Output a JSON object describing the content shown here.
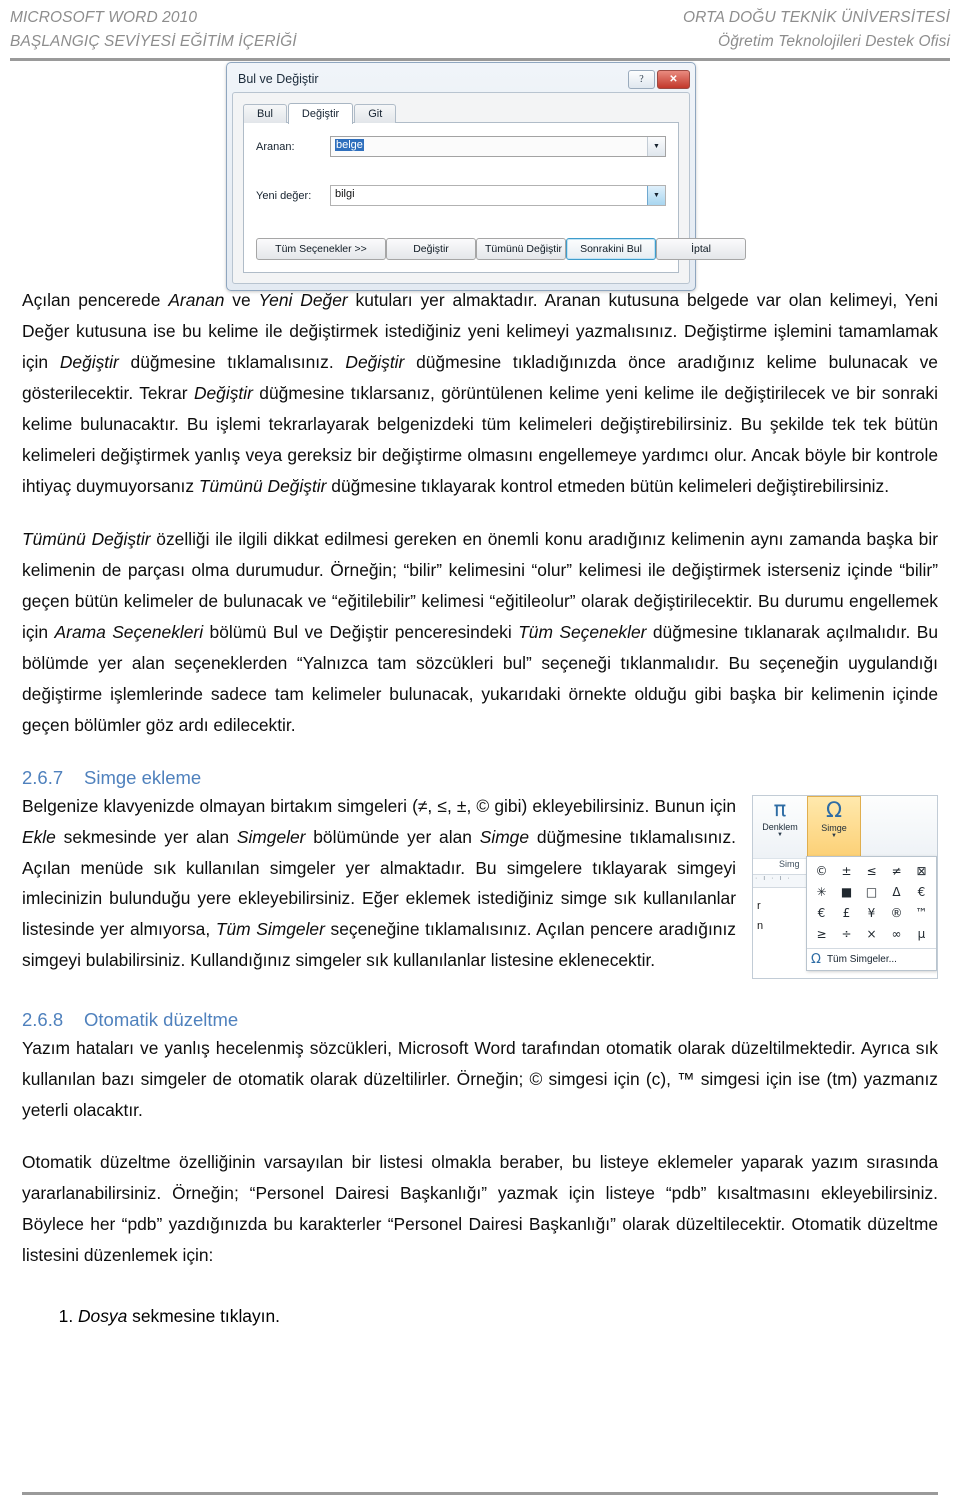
{
  "header": {
    "left_line1": "MICROSOFT WORD 2010",
    "left_line2": "BAŞLANGIÇ SEVİYESİ EĞİTİM İÇERİĞİ",
    "right_line1": "ORTA DOĞU TEKNİK ÜNİVERSİTESİ",
    "right_line2": "Öğretim Teknolojileri Destek Ofisi"
  },
  "dialog": {
    "title": "Bul ve Değiştir",
    "help_button": "?",
    "close_button": "✕",
    "tabs": [
      {
        "label": "Bul",
        "active": false
      },
      {
        "label": "Değiştir",
        "active": true
      },
      {
        "label": "Git",
        "active": false
      }
    ],
    "fields": [
      {
        "label": "Aranan:",
        "value": "belge",
        "selected": true
      },
      {
        "label": "Yeni değer:",
        "value": "bilgi",
        "selected": false
      }
    ],
    "buttons": {
      "all_options": "Tüm Seçenekler >>",
      "replace": "Değiştir",
      "replace_all": "Tümünü Değiştir",
      "find_next": "Sonrakini Bul",
      "cancel": "İptal"
    }
  },
  "body": {
    "p1_a": "Açılan pencerede ",
    "p1_i1": "Aranan",
    "p1_b": " ve ",
    "p1_i2": "Yeni Değer",
    "p1_c": " kutuları yer almaktadır. Aranan kutusuna belgede var olan kelimeyi, Yeni Değer kutusuna ise bu kelime ile değiştirmek istediğiniz yeni kelimeyi yazmalısınız. Değiştirme işlemini tamamlamak için ",
    "p1_i3": "Değiştir",
    "p1_d": " düğmesine tıklamalısınız. ",
    "p1_i4": "Değiştir",
    "p1_e": "  düğmesine tıkladığınızda önce aradığınız kelime bulunacak ve gösterilecektir. Tekrar ",
    "p1_i5": "Değiştir",
    "p1_f": " düğmesine tıklarsanız, görüntülenen kelime yeni kelime ile değiştirilecek ve bir sonraki kelime bulunacaktır. Bu işlemi tekrarlayarak belgenizdeki tüm kelimeleri değiştirebilirsiniz. Bu şekilde tek tek bütün kelimeleri değiştirmek yanlış veya gereksiz bir değiştirme olmasını engellemeye yardımcı olur. Ancak böyle bir kontrole ihtiyaç duymuyorsanız ",
    "p1_i6": "Tümünü Değiştir",
    "p1_g": " düğmesine tıklayarak kontrol etmeden bütün kelimeleri değiştirebilirsiniz.",
    "p2_i1": "Tümünü Değiştir",
    "p2_a": " özelliği ile ilgili dikkat edilmesi gereken en önemli konu aradığınız kelimenin aynı zamanda başka bir kelimenin de parçası olma durumudur. Örneğin; “bilir” kelimesini “olur” kelimesi ile değiştirmek isterseniz içinde “bilir” geçen bütün kelimeler de bulunacak ve “eğitilebilir” kelimesi “eğitileolur” olarak değiştirilecektir. Bu durumu engellemek için ",
    "p2_i2": "Arama Seçenekleri",
    "p2_b": " bölümü Bul ve Değiştir penceresindeki ",
    "p2_i3": "Tüm Seçenekler",
    "p2_c": " düğmesine tıklanarak açılmalıdır. Bu bölümde yer alan seçeneklerden “Yalnızca tam sözcükleri bul” seçeneği tıklanmalıdır. Bu seçeneğin uygulandığı değiştirme işlemlerinde sadece tam kelimeler bulunacak, yukarıdaki örnekte olduğu gibi başka bir kelimenin içinde geçen bölümler göz ardı edilecektir.",
    "h_simge_num": "2.6.7",
    "h_simge_title": "Simge ekleme",
    "p3_a": "Belgenize klavyenizde olmayan birtakım simgeleri (≠, ≤, ±, © gibi) ekleyebilirsiniz. Bunun için ",
    "p3_i1": "Ekle",
    "p3_b": " sekmesinde yer alan ",
    "p3_i2": "Simgeler",
    "p3_c": " bölümünde yer alan ",
    "p3_i3": "Simge",
    "p3_d": " düğmesine tıklamalısınız. Açılan menüde sık kullanılan simgeler yer almaktadır. Bu simgelere tıklayarak simgeyi imlecinizin bulunduğu yere ekleyebilirsiniz. Eğer eklemek istediğiniz simge sık kullanılanlar listesinde yer almıyorsa, ",
    "p3_i4": "Tüm Simgeler",
    "p3_e": " seçeneğine tıklamalısınız. Açılan pencere aradığınız simgeyi bulabilirsiniz. Kullandığınız simgeler sık kullanılanlar listesine eklenecektir.",
    "h_oto_num": "2.6.8",
    "h_oto_title": "Otomatik düzeltme",
    "p4": "Yazım hataları ve yanlış hecelenmiş sözcükleri, Microsoft Word tarafından otomatik olarak düzeltilmektedir. Ayrıca sık kullanılan bazı simgeler de otomatik olarak düzeltilirler. Örneğin; © simgesi için (c), ™ simgesi için ise (tm) yazmanız yeterli olacaktır.",
    "p5": "Otomatik düzeltme özelliğinin varsayılan bir listesi olmakla beraber, bu listeye eklemeler yaparak yazım sırasında yararlanabilirsiniz. Örneğin; “Personel Dairesi Başkanlığı” yazmak için listeye “pdb” kısaltmasını ekleyebilirsiniz. Böylece her “pdb” yazdığınızda bu karakterler “Personel Dairesi Başkanlığı” olarak düzeltilecektir. Otomatik düzeltme listesini düzenlemek için:",
    "step1_i": "Dosya",
    "step1_rest": " sekmesine tıklayın."
  },
  "ribbon": {
    "equation_label": "Denklem",
    "equation_glyph": "π",
    "symbol_label": "Simge",
    "symbol_glyph": "Ω",
    "group_label": "Simg",
    "dropdown_caret": "▼",
    "doc_line1": "r",
    "doc_line2": "n",
    "ruler_ticks": "· ı · ı ·",
    "symbols": [
      "©",
      "±",
      "≤",
      "≠",
      "⊠",
      "✳",
      "■",
      "□",
      "Δ",
      "€",
      "€",
      "£",
      "¥",
      "®",
      "™",
      "≥",
      "÷",
      "×",
      "∞",
      "µ"
    ],
    "all_symbols_label": "Tüm Simgeler...",
    "all_symbols_glyph": "Ω"
  },
  "colors": {
    "heading": "#4F81BD",
    "header_text": "#8D8D8D",
    "selection": "#2F6FBD",
    "ribbon_active": "#FCD076"
  }
}
